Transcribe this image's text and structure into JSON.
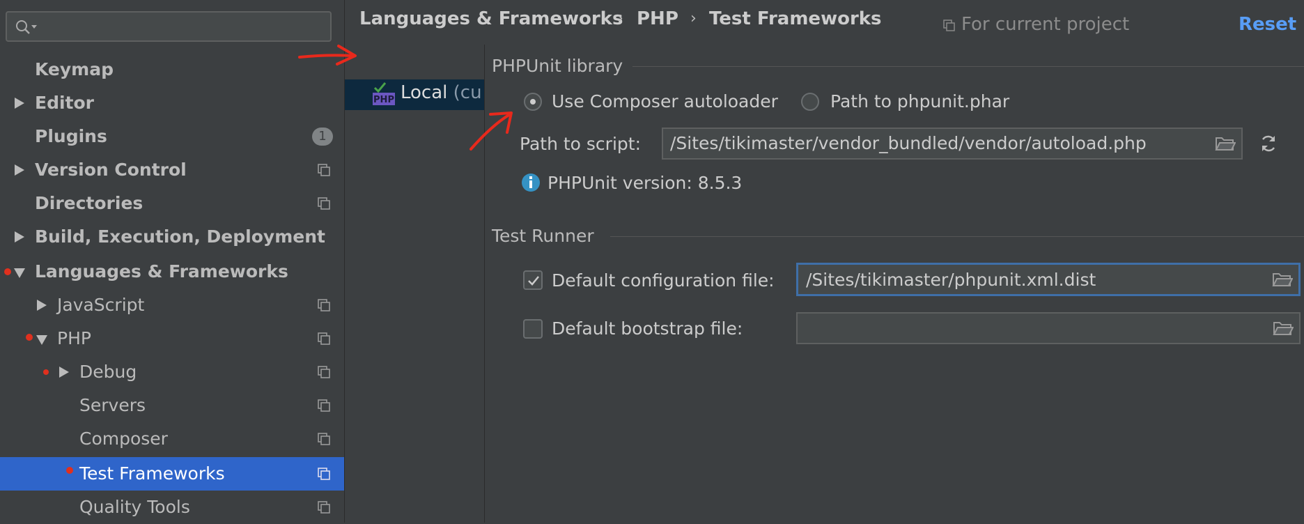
{
  "sidebar": {
    "search": {
      "value": "",
      "placeholder": ""
    },
    "items": [
      {
        "label": "Keymap"
      },
      {
        "label": "Editor"
      },
      {
        "label": "Plugins",
        "badge": "1"
      },
      {
        "label": "Version Control"
      },
      {
        "label": "Directories"
      },
      {
        "label": "Build, Execution, Deployment"
      },
      {
        "label": "Languages & Frameworks"
      },
      {
        "label": "JavaScript"
      },
      {
        "label": "PHP"
      },
      {
        "label": "Debug"
      },
      {
        "label": "Servers"
      },
      {
        "label": "Composer"
      },
      {
        "label": "Test Frameworks"
      },
      {
        "label": "Quality Tools"
      }
    ]
  },
  "header": {
    "breadcrumbs": [
      "Languages & Frameworks",
      "PHP",
      "Test Frameworks"
    ],
    "separator": "›",
    "scope_label": "For current project",
    "reset_label": "Reset"
  },
  "list": {
    "add_label": "+",
    "remove_label": "−",
    "items": [
      {
        "label": "Local",
        "suffix": " (cu"
      }
    ],
    "icon_text": "PHP"
  },
  "phpunit": {
    "section_title": "PHPUnit library",
    "option_composer": "Use Composer autoloader",
    "option_phar": "Path to phpunit.phar",
    "path_label": "Path to script:",
    "path_value": "/Sites/tikimaster/vendor_bundled/vendor/autoload.php",
    "version_text": "PHPUnit version: 8.5.3"
  },
  "test_runner": {
    "section_title": "Test Runner",
    "default_config_label": "Default configuration file:",
    "default_config_value": "/Sites/tikimaster/phpunit.xml.dist",
    "default_bootstrap_label": "Default bootstrap file:",
    "default_bootstrap_value": ""
  },
  "colors": {
    "background": "#3c3f41",
    "selection": "#2f65ca",
    "link": "#589df6",
    "modified_dot": "#e0301e",
    "annotation_arrow": "#e8291c"
  }
}
